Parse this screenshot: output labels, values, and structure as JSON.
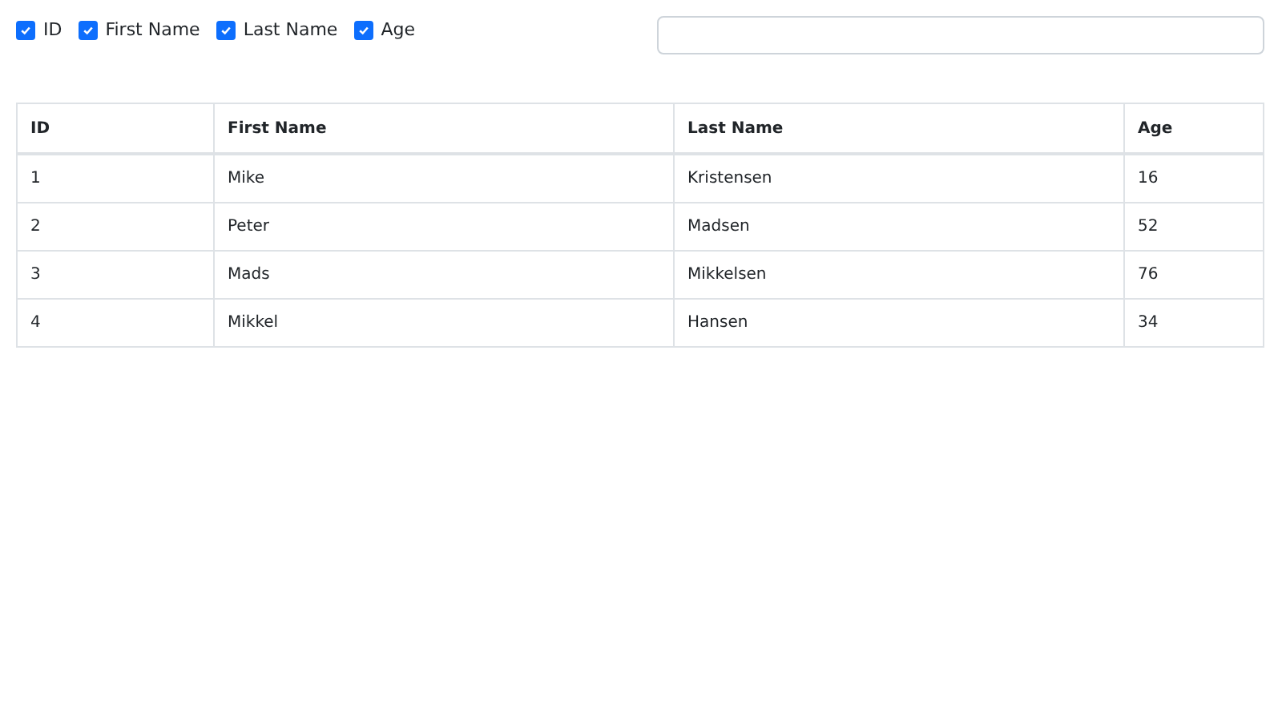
{
  "column_toggles": [
    {
      "label": "ID",
      "checked": true
    },
    {
      "label": "First Name",
      "checked": true
    },
    {
      "label": "Last Name",
      "checked": true
    },
    {
      "label": "Age",
      "checked": true
    }
  ],
  "table": {
    "columns": [
      "ID",
      "First Name",
      "Last Name",
      "Age"
    ],
    "rows": [
      [
        "1",
        "Mike",
        "Kristensen",
        "16"
      ],
      [
        "2",
        "Peter",
        "Madsen",
        "52"
      ],
      [
        "3",
        "Mads",
        "Mikkelsen",
        "76"
      ],
      [
        "4",
        "Mikkel",
        "Hansen",
        "34"
      ]
    ]
  }
}
